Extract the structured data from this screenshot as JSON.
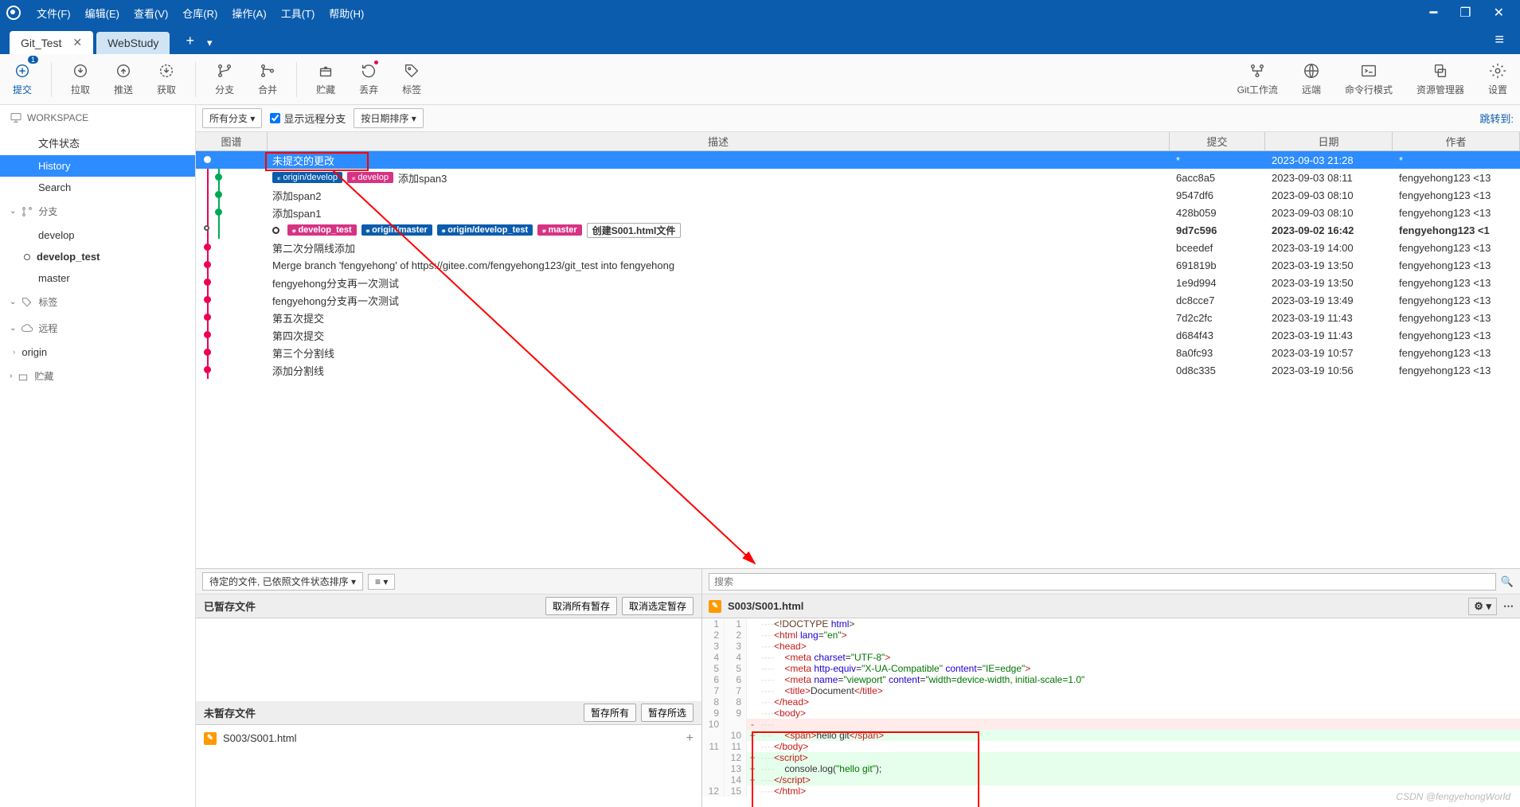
{
  "menu": [
    "文件(F)",
    "编辑(E)",
    "查看(V)",
    "仓库(R)",
    "操作(A)",
    "工具(T)",
    "帮助(H)"
  ],
  "tabs": [
    {
      "label": "Git_Test",
      "active": true
    },
    {
      "label": "WebStudy",
      "active": false
    }
  ],
  "toolbar": {
    "commit": "提交",
    "pull": "拉取",
    "push": "推送",
    "fetch": "获取",
    "branch": "分支",
    "merge": "合并",
    "stash": "贮藏",
    "discard": "丢弃",
    "tag": "标签",
    "gitflow": "Git工作流",
    "remote": "远端",
    "terminal": "命令行模式",
    "explorer": "资源管理器",
    "settings": "设置",
    "commit_badge": "1"
  },
  "sidebar": {
    "workspace": {
      "title": "WORKSPACE",
      "items": [
        "文件状态",
        "History",
        "Search"
      ],
      "selected": 1
    },
    "branches": {
      "title": "分支",
      "items": [
        {
          "name": "develop",
          "active": false
        },
        {
          "name": "develop_test",
          "active": true
        },
        {
          "name": "master",
          "active": false
        }
      ]
    },
    "tags": {
      "title": "标签"
    },
    "remotes": {
      "title": "远程",
      "items": [
        "origin"
      ]
    },
    "stashes": {
      "title": "贮藏"
    }
  },
  "filter": {
    "all_branches": "所有分支",
    "show_remote": "显示远程分支",
    "show_remote_checked": true,
    "sort": "按日期排序",
    "jump": "跳转到:"
  },
  "grid_headers": {
    "graph": "图谱",
    "desc": "描述",
    "commit": "提交",
    "date": "日期",
    "author": "作者"
  },
  "commits": [
    {
      "selected": true,
      "desc": "未提交的更改",
      "refs": [],
      "commit": "*",
      "date": "2023-09-03 21:28",
      "author": "*"
    },
    {
      "refs": [
        {
          "t": "remote",
          "n": "origin/develop"
        },
        {
          "t": "local",
          "n": "develop"
        }
      ],
      "desc": "添加span3",
      "commit": "6acc8a5",
      "date": "2023-09-03 08:11",
      "author": "fengyehong123 <13"
    },
    {
      "desc": "添加span2",
      "commit": "9547df6",
      "date": "2023-09-03 08:10",
      "author": "fengyehong123 <13"
    },
    {
      "desc": "添加span1",
      "commit": "428b059",
      "date": "2023-09-03 08:10",
      "author": "fengyehong123 <13"
    },
    {
      "bold": true,
      "checkout": true,
      "refs": [
        {
          "t": "local",
          "n": "develop_test"
        },
        {
          "t": "remote",
          "n": "origin/master"
        },
        {
          "t": "remote",
          "n": "origin/develop_test"
        },
        {
          "t": "local",
          "n": "master"
        }
      ],
      "desc_box": "创建S001.html文件",
      "commit": "9d7c596",
      "date": "2023-09-02 16:42",
      "author": "fengyehong123 <1"
    },
    {
      "desc": "第二次分隔线添加",
      "commit": "bceedef",
      "date": "2023-03-19 14:00",
      "author": "fengyehong123 <13"
    },
    {
      "desc": "Merge branch 'fengyehong' of https://gitee.com/fengyehong123/git_test into fengyehong",
      "commit": "691819b",
      "date": "2023-03-19 13:50",
      "author": "fengyehong123 <13"
    },
    {
      "desc": "fengyehong分支再一次测试",
      "commit": "1e9d994",
      "date": "2023-03-19 13:50",
      "author": "fengyehong123 <13"
    },
    {
      "desc": "fengyehong分支再一次测试",
      "commit": "dc8cce7",
      "date": "2023-03-19 13:49",
      "author": "fengyehong123 <13"
    },
    {
      "desc": "第五次提交",
      "commit": "7d2c2fc",
      "date": "2023-03-19 11:43",
      "author": "fengyehong123 <13"
    },
    {
      "desc": "第四次提交",
      "commit": "d684f43",
      "date": "2023-03-19 11:43",
      "author": "fengyehong123 <13"
    },
    {
      "desc": "第三个分割线",
      "commit": "8a0fc93",
      "date": "2023-03-19 10:57",
      "author": "fengyehong123 <13"
    },
    {
      "desc": "添加分割线",
      "commit": "0d8c335",
      "date": "2023-03-19 10:56",
      "author": "fengyehong123 <13"
    }
  ],
  "bottom": {
    "pending_sort": "待定的文件, 已依照文件状态排序",
    "search_placeholder": "搜索",
    "staged": {
      "title": "已暂存文件",
      "unstage_all": "取消所有暂存",
      "unstage_sel": "取消选定暂存"
    },
    "unstaged": {
      "title": "未暂存文件",
      "stage_all": "暂存所有",
      "stage_sel": "暂存所选",
      "files": [
        "S003/S001.html"
      ]
    },
    "diff": {
      "file": "S003/S001.html",
      "lines": [
        {
          "a": "1",
          "b": "1",
          "g": "",
          "cls": "",
          "html": "<span class='syn-decl'>&lt;!DOCTYPE</span> <span class='syn-attr'>html</span><span class='syn-decl'>&gt;</span>"
        },
        {
          "a": "2",
          "b": "2",
          "g": "",
          "cls": "",
          "html": "<span class='syn-tag'>&lt;html</span> <span class='syn-attr'>lang</span>=<span class='syn-str'>\"en\"</span><span class='syn-tag'>&gt;</span>"
        },
        {
          "a": "3",
          "b": "3",
          "g": "",
          "cls": "",
          "html": "<span class='syn-tag'>&lt;head&gt;</span>"
        },
        {
          "a": "4",
          "b": "4",
          "g": "",
          "cls": "",
          "html": "    <span class='syn-tag'>&lt;meta</span> <span class='syn-attr'>charset</span>=<span class='syn-str'>\"UTF-8\"</span><span class='syn-tag'>&gt;</span>"
        },
        {
          "a": "5",
          "b": "5",
          "g": "",
          "cls": "",
          "html": "    <span class='syn-tag'>&lt;meta</span> <span class='syn-attr'>http-equiv</span>=<span class='syn-str'>\"X-UA-Compatible\"</span> <span class='syn-attr'>content</span>=<span class='syn-str'>\"IE=edge\"</span><span class='syn-tag'>&gt;</span>"
        },
        {
          "a": "6",
          "b": "6",
          "g": "",
          "cls": "",
          "html": "    <span class='syn-tag'>&lt;meta</span> <span class='syn-attr'>name</span>=<span class='syn-str'>\"viewport\"</span> <span class='syn-attr'>content</span>=<span class='syn-str'>\"width=device-width, initial-scale=1.0\"</span>"
        },
        {
          "a": "7",
          "b": "7",
          "g": "",
          "cls": "",
          "html": "    <span class='syn-tag'>&lt;title&gt;</span>Document<span class='syn-tag'>&lt;/title&gt;</span>"
        },
        {
          "a": "8",
          "b": "8",
          "g": "",
          "cls": "",
          "html": "<span class='syn-tag'>&lt;/head&gt;</span>"
        },
        {
          "a": "9",
          "b": "9",
          "g": "",
          "cls": "",
          "html": "<span class='syn-tag'>&lt;body&gt;</span>"
        },
        {
          "a": "10",
          "b": "",
          "g": "-",
          "cls": "del",
          "html": ""
        },
        {
          "a": "",
          "b": "10",
          "g": "+",
          "cls": "add",
          "html": "    <span class='syn-tag'>&lt;span&gt;</span>hello git<span class='syn-tag'>&lt;/span&gt;</span>"
        },
        {
          "a": "11",
          "b": "11",
          "g": "",
          "cls": "",
          "html": "<span class='syn-tag'>&lt;/body&gt;</span>"
        },
        {
          "a": "",
          "b": "12",
          "g": "+",
          "cls": "add",
          "html": "<span class='syn-tag'>&lt;script&gt;</span>"
        },
        {
          "a": "",
          "b": "13",
          "g": "+",
          "cls": "add",
          "html": "    console.log(<span class='syn-str'>\"hello git\"</span>);"
        },
        {
          "a": "",
          "b": "14",
          "g": "+",
          "cls": "add",
          "html": "<span class='syn-tag'>&lt;/script&gt;</span>"
        },
        {
          "a": "12",
          "b": "15",
          "g": "",
          "cls": "",
          "html": "<span class='syn-tag'>&lt;/html&gt;</span>"
        }
      ]
    }
  },
  "watermark": "CSDN @fengyehongWorld"
}
